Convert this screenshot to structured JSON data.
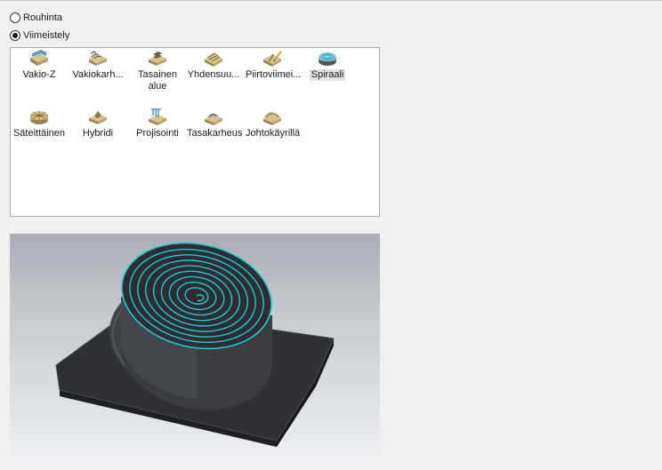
{
  "operation_mode": {
    "options": [
      {
        "label": "Rouhinta",
        "selected": false
      },
      {
        "label": "Viimeistely",
        "selected": true
      }
    ]
  },
  "strategies": {
    "selected": "Spiraali",
    "items": [
      {
        "label": "Vakio-Z",
        "icon": "constant-z-icon"
      },
      {
        "label": "Vakiokarh...",
        "icon": "constant-scallop-icon"
      },
      {
        "label": "Tasainen alue",
        "icon": "flat-area-icon"
      },
      {
        "label": "Yhdensuu...",
        "icon": "parallel-icon"
      },
      {
        "label": "Piirtoviimei...",
        "icon": "pencil-finish-icon"
      },
      {
        "label": "Spiraali",
        "icon": "spiral-icon"
      },
      {
        "label": "Säteittäinen",
        "icon": "radial-icon"
      },
      {
        "label": "Hybridi",
        "icon": "hybrid-icon"
      },
      {
        "label": "Projisointi",
        "icon": "projection-icon"
      },
      {
        "label": "Tasakarheus",
        "icon": "uniform-scallop-icon"
      },
      {
        "label": "Johtokäyrillä",
        "icon": "flowline-icon"
      }
    ]
  },
  "preview": {
    "description_icon": "spiral-toolpath-preview",
    "colors": {
      "toolpath": "#27c6d4",
      "part": "#3b3d40",
      "background_top": "#a9aeb4"
    }
  }
}
